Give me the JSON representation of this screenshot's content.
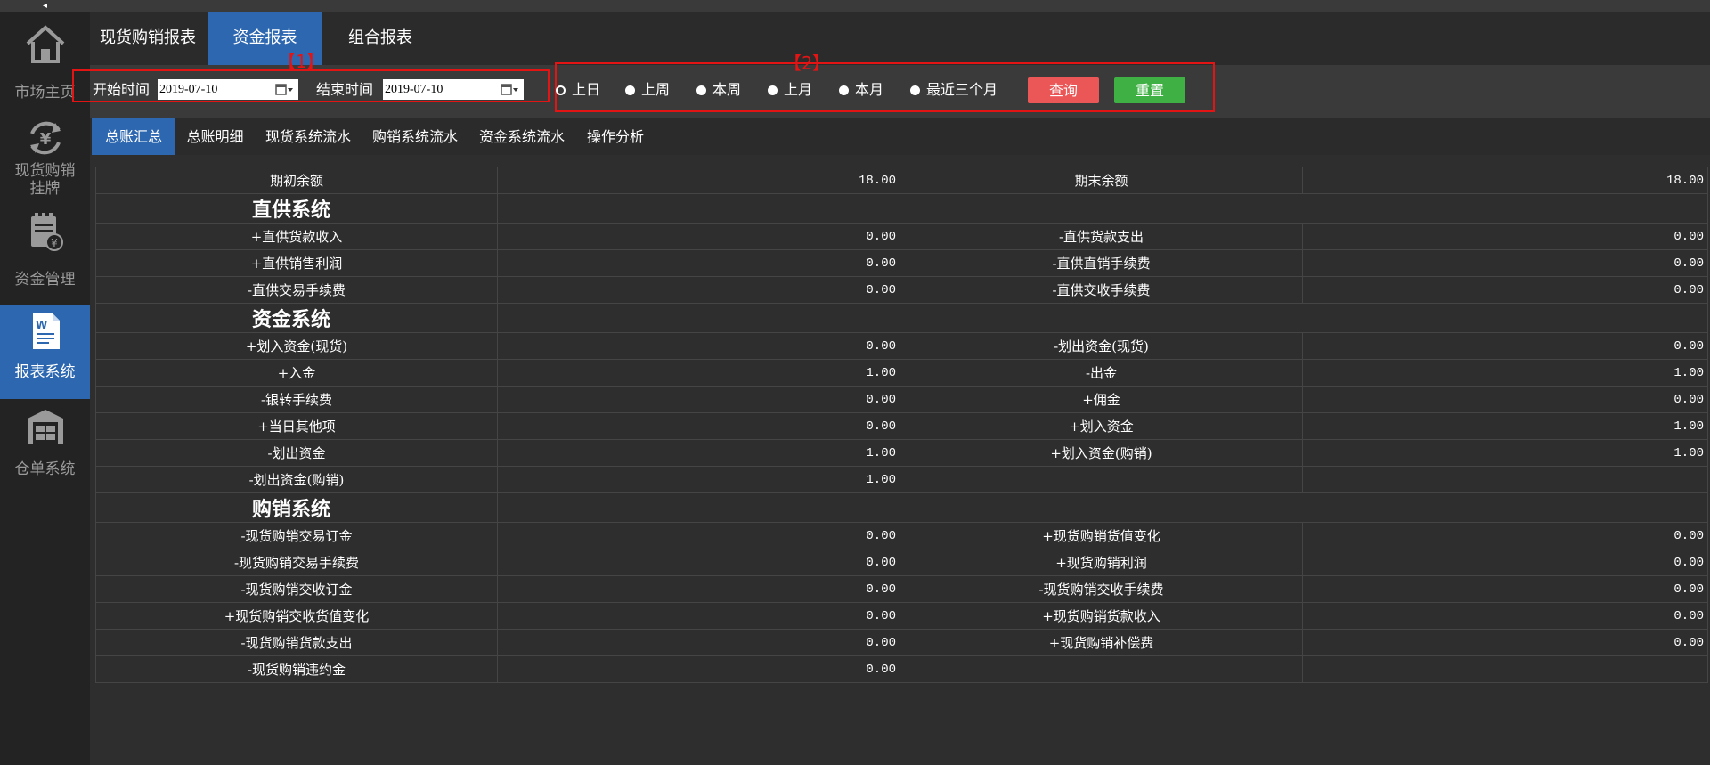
{
  "sidebar": {
    "collapse_glyph": "◂",
    "items": [
      {
        "label": "市场主页",
        "icon": "home-icon"
      },
      {
        "label": "现货购销挂牌",
        "icon": "yen-cycle-icon"
      },
      {
        "label": "资金管理",
        "icon": "money-clipboard-icon"
      },
      {
        "label": "报表系统",
        "icon": "word-document-icon",
        "active": true
      },
      {
        "label": "仓单系统",
        "icon": "warehouse-icon"
      }
    ]
  },
  "report_tabs": [
    {
      "label": "现货购销报表"
    },
    {
      "label": "资金报表",
      "active": true
    },
    {
      "label": "组合报表"
    }
  ],
  "filter": {
    "start_label": "开始时间",
    "start_value": "2019-07-10",
    "end_label": "结束时间",
    "end_value": "2019-07-10",
    "marker1": "【1】",
    "marker2": "【2】",
    "periods": [
      "上日",
      "上周",
      "本周",
      "上月",
      "本月",
      "最近三个月"
    ],
    "query_label": "查询",
    "reset_label": "重置"
  },
  "sub_tabs": [
    {
      "label": "总账汇总",
      "active": true
    },
    {
      "label": "总账明细"
    },
    {
      "label": "现货系统流水"
    },
    {
      "label": "购销系统流水"
    },
    {
      "label": "资金系统流水"
    },
    {
      "label": "操作分析"
    }
  ],
  "ledger": {
    "opening": {
      "label": "期初余额",
      "value": "18.00"
    },
    "closing": {
      "label": "期末余额",
      "value": "18.00"
    },
    "sections": [
      {
        "title": "直供系统",
        "rows": [
          [
            "+直供货款收入",
            "0.00",
            "-直供货款支出",
            "0.00"
          ],
          [
            "+直供销售利润",
            "0.00",
            "-直供直销手续费",
            "0.00"
          ],
          [
            "-直供交易手续费",
            "0.00",
            "-直供交收手续费",
            "0.00"
          ]
        ]
      },
      {
        "title": "资金系统",
        "rows": [
          [
            "+划入资金(现货)",
            "0.00",
            "-划出资金(现货)",
            "0.00"
          ],
          [
            "+入金",
            "1.00",
            "-出金",
            "1.00"
          ],
          [
            "-银转手续费",
            "0.00",
            "+佣金",
            "0.00"
          ],
          [
            "+当日其他项",
            "0.00",
            "+划入资金",
            "1.00"
          ],
          [
            "-划出资金",
            "1.00",
            "+划入资金(购销)",
            "1.00"
          ],
          [
            "-划出资金(购销)",
            "1.00",
            "",
            ""
          ]
        ]
      },
      {
        "title": "购销系统",
        "rows": [
          [
            "-现货购销交易订金",
            "0.00",
            "+现货购销货值变化",
            "0.00"
          ],
          [
            "-现货购销交易手续费",
            "0.00",
            "+现货购销利润",
            "0.00"
          ],
          [
            "-现货购销交收订金",
            "0.00",
            "-现货购销交收手续费",
            "0.00"
          ],
          [
            "+现货购销交收货值变化",
            "0.00",
            "+现货购销货款收入",
            "0.00"
          ],
          [
            "-现货购销货款支出",
            "0.00",
            "+现货购销补偿费",
            "0.00"
          ],
          [
            "-现货购销违约金",
            "0.00",
            "",
            ""
          ]
        ]
      }
    ]
  }
}
